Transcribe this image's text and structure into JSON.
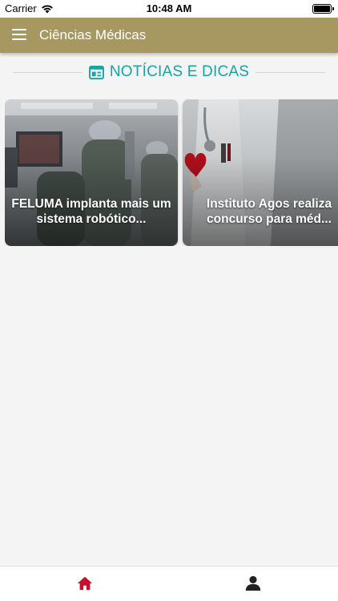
{
  "status_bar": {
    "carrier": "Carrier",
    "time": "10:48 AM"
  },
  "app_bar": {
    "title": "Ciências Médicas",
    "color": "#a79761"
  },
  "section": {
    "title": "NOTÍCIAS E DICAS",
    "icon": "newspaper-icon",
    "color": "#1aa3a3"
  },
  "news": [
    {
      "title": "FELUMA implanta mais um sistema robótico..."
    },
    {
      "title": "Instituto Agos realiza concurso para méd..."
    }
  ],
  "tab_bar": {
    "items": [
      {
        "icon": "home-icon",
        "active": true,
        "color": "#c8102e"
      },
      {
        "icon": "user-icon",
        "active": false,
        "color": "#222222"
      }
    ]
  }
}
